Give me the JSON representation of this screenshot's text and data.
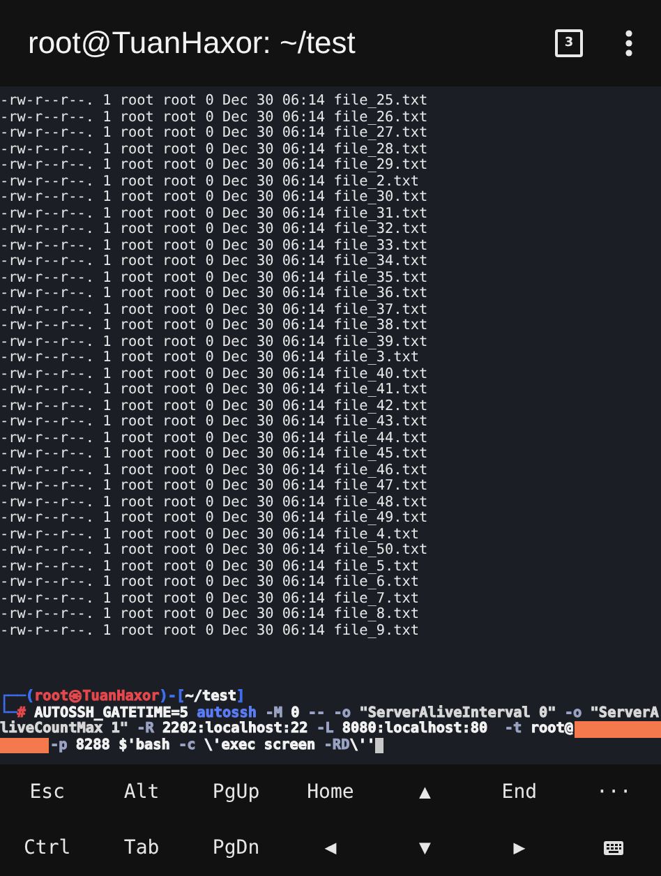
{
  "header": {
    "title": "root@TuanHaxor: ~/test",
    "session_count": "3"
  },
  "terminal": {
    "output_lines": [
      "-rw-r--r--. 1 root root 0 Dec 30 06:14 file_25.txt",
      "-rw-r--r--. 1 root root 0 Dec 30 06:14 file_26.txt",
      "-rw-r--r--. 1 root root 0 Dec 30 06:14 file_27.txt",
      "-rw-r--r--. 1 root root 0 Dec 30 06:14 file_28.txt",
      "-rw-r--r--. 1 root root 0 Dec 30 06:14 file_29.txt",
      "-rw-r--r--. 1 root root 0 Dec 30 06:14 file_2.txt",
      "-rw-r--r--. 1 root root 0 Dec 30 06:14 file_30.txt",
      "-rw-r--r--. 1 root root 0 Dec 30 06:14 file_31.txt",
      "-rw-r--r--. 1 root root 0 Dec 30 06:14 file_32.txt",
      "-rw-r--r--. 1 root root 0 Dec 30 06:14 file_33.txt",
      "-rw-r--r--. 1 root root 0 Dec 30 06:14 file_34.txt",
      "-rw-r--r--. 1 root root 0 Dec 30 06:14 file_35.txt",
      "-rw-r--r--. 1 root root 0 Dec 30 06:14 file_36.txt",
      "-rw-r--r--. 1 root root 0 Dec 30 06:14 file_37.txt",
      "-rw-r--r--. 1 root root 0 Dec 30 06:14 file_38.txt",
      "-rw-r--r--. 1 root root 0 Dec 30 06:14 file_39.txt",
      "-rw-r--r--. 1 root root 0 Dec 30 06:14 file_3.txt",
      "-rw-r--r--. 1 root root 0 Dec 30 06:14 file_40.txt",
      "-rw-r--r--. 1 root root 0 Dec 30 06:14 file_41.txt",
      "-rw-r--r--. 1 root root 0 Dec 30 06:14 file_42.txt",
      "-rw-r--r--. 1 root root 0 Dec 30 06:14 file_43.txt",
      "-rw-r--r--. 1 root root 0 Dec 30 06:14 file_44.txt",
      "-rw-r--r--. 1 root root 0 Dec 30 06:14 file_45.txt",
      "-rw-r--r--. 1 root root 0 Dec 30 06:14 file_46.txt",
      "-rw-r--r--. 1 root root 0 Dec 30 06:14 file_47.txt",
      "-rw-r--r--. 1 root root 0 Dec 30 06:14 file_48.txt",
      "-rw-r--r--. 1 root root 0 Dec 30 06:14 file_49.txt",
      "-rw-r--r--. 1 root root 0 Dec 30 06:14 file_4.txt",
      "-rw-r--r--. 1 root root 0 Dec 30 06:14 file_50.txt",
      "-rw-r--r--. 1 root root 0 Dec 30 06:14 file_5.txt",
      "-rw-r--r--. 1 root root 0 Dec 30 06:14 file_6.txt",
      "-rw-r--r--. 1 root root 0 Dec 30 06:14 file_7.txt",
      "-rw-r--r--. 1 root root 0 Dec 30 06:14 file_8.txt",
      "-rw-r--r--. 1 root root 0 Dec 30 06:14 file_9.txt"
    ],
    "prompt_lines": [
      {
        "segments": [
          {
            "kind": "text",
            "text": "┌──(",
            "color": "#3f6ff0"
          },
          {
            "kind": "text",
            "text": "root㉿TuanHaxor",
            "color": "#e5484d"
          },
          {
            "kind": "text",
            "text": ")-[",
            "color": "#3f6ff0"
          },
          {
            "kind": "text",
            "text": "~/test",
            "color": "#f2f2f2"
          },
          {
            "kind": "text",
            "text": "]",
            "color": "#3f6ff0"
          }
        ]
      },
      {
        "segments": [
          {
            "kind": "text",
            "text": "└─",
            "color": "#3f6ff0"
          },
          {
            "kind": "text",
            "text": "# ",
            "color": "#e5484d"
          },
          {
            "kind": "text",
            "text": "AUTOSSH_GATETIME=5 ",
            "color": "#f2f2f2"
          },
          {
            "kind": "text",
            "text": "autossh ",
            "color": "#5b7df5"
          },
          {
            "kind": "text",
            "text": "-M ",
            "color": "#9aa3c4"
          },
          {
            "kind": "text",
            "text": "0 ",
            "color": "#f2f2f2"
          },
          {
            "kind": "text",
            "text": "-- -o ",
            "color": "#9aa3c4"
          },
          {
            "kind": "text",
            "text": "\"ServerAliveInterval 0\" ",
            "color": "#d8d8d8"
          },
          {
            "kind": "text",
            "text": "-o ",
            "color": "#9aa3c4"
          },
          {
            "kind": "text",
            "text": "\"ServerA",
            "color": "#d8d8d8"
          }
        ]
      },
      {
        "segments": [
          {
            "kind": "text",
            "text": "liveCountMax 1\" ",
            "color": "#d8d8d8"
          },
          {
            "kind": "text",
            "text": "-R ",
            "color": "#9aa3c4"
          },
          {
            "kind": "text",
            "text": "2202:localhost:22 ",
            "color": "#f2f2f2"
          },
          {
            "kind": "text",
            "text": "-L ",
            "color": "#9aa3c4"
          },
          {
            "kind": "text",
            "text": "8080:localhost:80  ",
            "color": "#f2f2f2"
          },
          {
            "kind": "text",
            "text": "-t ",
            "color": "#9aa3c4"
          },
          {
            "kind": "text",
            "text": "root@",
            "color": "#f2f2f2"
          },
          {
            "kind": "redacted-tail"
          }
        ]
      },
      {
        "segments": [
          {
            "kind": "redacted"
          },
          {
            "kind": "text",
            "text": "-p ",
            "color": "#9aa3c4"
          },
          {
            "kind": "text",
            "text": "8288 $'bash ",
            "color": "#f2f2f2"
          },
          {
            "kind": "text",
            "text": "-c ",
            "color": "#9aa3c4"
          },
          {
            "kind": "text",
            "text": "\\'exec screen ",
            "color": "#f2f2f2"
          },
          {
            "kind": "text",
            "text": "-RD",
            "color": "#9aa3c4"
          },
          {
            "kind": "text",
            "text": "\\''",
            "color": "#f2f2f2"
          },
          {
            "kind": "cursor"
          }
        ]
      }
    ]
  },
  "extra_keys": [
    [
      {
        "kind": "text",
        "label": "Esc"
      },
      {
        "kind": "text",
        "label": "Alt"
      },
      {
        "kind": "text",
        "label": "PgUp"
      },
      {
        "kind": "text",
        "label": "Home"
      },
      {
        "kind": "text",
        "label": "▲"
      },
      {
        "kind": "text",
        "label": "End"
      },
      {
        "kind": "text",
        "label": "···"
      }
    ],
    [
      {
        "kind": "text",
        "label": "Ctrl"
      },
      {
        "kind": "text",
        "label": "Tab"
      },
      {
        "kind": "text",
        "label": "PgDn"
      },
      {
        "kind": "text",
        "label": "◀"
      },
      {
        "kind": "text",
        "label": "▼"
      },
      {
        "kind": "text",
        "label": "▶"
      },
      {
        "kind": "keyboard"
      }
    ]
  ]
}
